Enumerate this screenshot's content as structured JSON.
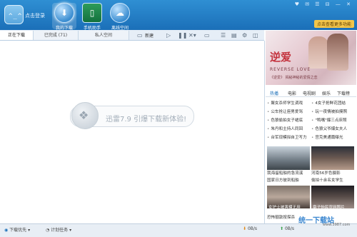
{
  "header": {
    "login_label": "点击登录",
    "nav": [
      {
        "label": "我的下载",
        "icon": "download-icon"
      },
      {
        "label": "手机助手",
        "icon": "phone-icon"
      },
      {
        "label": "离线空间",
        "icon": "cloud-icon"
      }
    ],
    "window_controls": "♥ ✉ ☰ ⊟ —  ✕",
    "more_features": "点击查看更多功能"
  },
  "tabs": [
    {
      "label": "正在下载",
      "active": true
    },
    {
      "label": "已完成 (71)",
      "active": false
    },
    {
      "label": "私人空间",
      "active": false
    }
  ],
  "toolbar": {
    "new_label": "新建",
    "icons": [
      "new-task-icon",
      "play-icon",
      "pause-icon",
      "delete-icon",
      "folder-icon",
      "list-view-icon",
      "detail-view-icon",
      "settings-icon",
      "collapse-icon"
    ]
  },
  "main": {
    "promo_text": "迅雷7.9 引爆下载新体验!"
  },
  "footer": {
    "priority_label": "下载优先",
    "schedule_label": "计划任务",
    "down_speed": "0B/s",
    "up_speed": "0B/s"
  },
  "right_panel": {
    "banner": {
      "title": "逆爱",
      "english": "REVERSE LOVE",
      "subtitle": "《逆爱》 揭秘神秘的爱情之恋"
    },
    "categories": [
      {
        "label": "热播",
        "active": true
      },
      {
        "label": "电影",
        "active": false
      },
      {
        "label": "电视剧",
        "active": false
      },
      {
        "label": "娱乐",
        "active": false
      },
      {
        "label": "下载榜",
        "active": false
      }
    ],
    "news_left": [
      "聚女杀师学生调戏",
      "公车抢让座男爱骂",
      "色狼偷拍女子裙底",
      "朱丹和主持人同回",
      "台军现模拟自卫写力"
    ],
    "news_right": [
      "4女子抢鲜花团结",
      "玩一夜情被拍摸照",
      "\"鸭嘴\"爆三点床照",
      "色狼父爷爆女夫人",
      "宫克美通篇曝光"
    ],
    "thumbs": [
      {
        "caption": "我海留船舶的急流溪",
        "sub": "国家日方彼到船舶"
      },
      {
        "caption": "河南56岁色摄影",
        "sub": "偷拍十余名女学生"
      },
      {
        "caption": "女护士被害模无用",
        "sub": "恐怖靓敦按探杀"
      },
      {
        "caption": "章子怡民宣网照片",
        "sub": ""
      }
    ]
  },
  "watermark": {
    "text": "统一下载站",
    "url": "www.3987.com"
  }
}
